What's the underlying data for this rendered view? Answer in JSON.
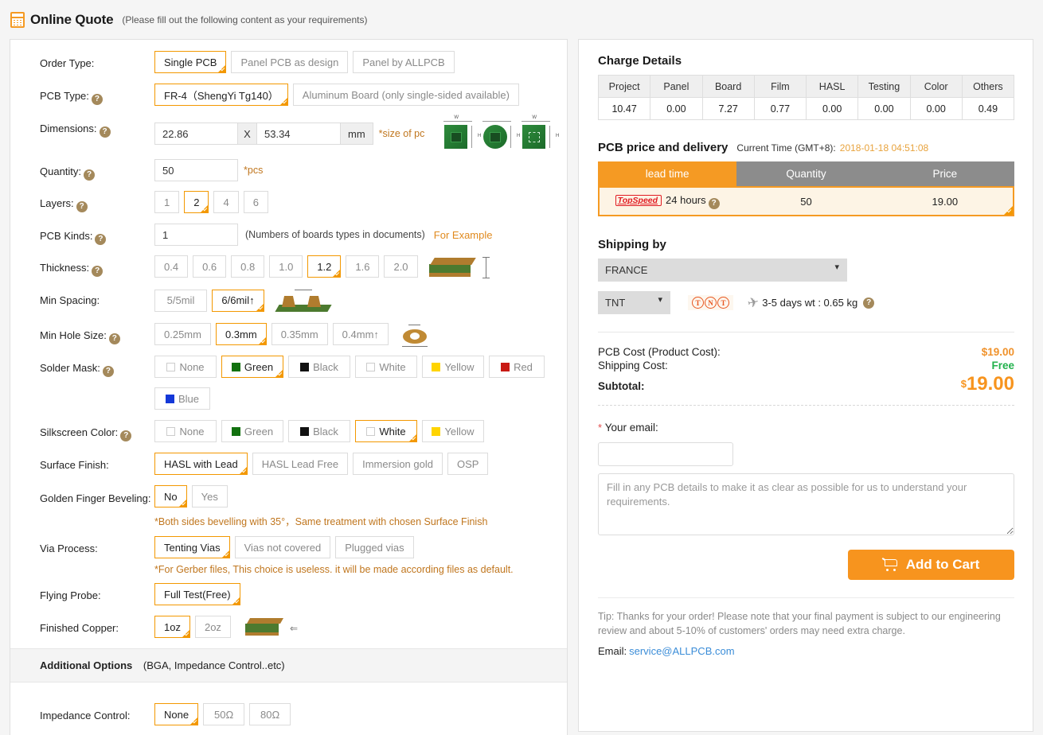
{
  "header": {
    "title": "Online Quote",
    "note": "(Please fill out the following content as your requirements)",
    "icon": "calculator-icon"
  },
  "form": {
    "order_type": {
      "label": "Order Type:",
      "options": [
        "Single PCB",
        "Panel PCB as design",
        "Panel by ALLPCB"
      ],
      "selected": "Single PCB"
    },
    "pcb_type": {
      "label": "PCB Type:",
      "options": [
        "FR-4（ShengYi Tg140）",
        "Aluminum Board (only single-sided available)"
      ],
      "selected": "FR-4（ShengYi Tg140）"
    },
    "dimensions": {
      "label": "Dimensions:",
      "width": "22.86",
      "separator": "X",
      "height": "53.34",
      "unit": "mm",
      "note": "*size of pc"
    },
    "quantity": {
      "label": "Quantity:",
      "value": "50",
      "note": "*pcs"
    },
    "layers": {
      "label": "Layers:",
      "options": [
        "1",
        "2",
        "4",
        "6"
      ],
      "selected": "2"
    },
    "pcb_kinds": {
      "label": "PCB Kinds:",
      "value": "1",
      "note": "(Numbers of boards types in documents)",
      "link": "For Example"
    },
    "thickness": {
      "label": "Thickness:",
      "options": [
        "0.4",
        "0.6",
        "0.8",
        "1.0",
        "1.2",
        "1.6",
        "2.0"
      ],
      "selected": "1.2"
    },
    "min_spacing": {
      "label": "Min Spacing:",
      "options": [
        "5/5mil",
        "6/6mil↑"
      ],
      "selected": "6/6mil↑"
    },
    "min_hole_size": {
      "label": "Min Hole Size:",
      "options": [
        "0.25mm",
        "0.3mm",
        "0.35mm",
        "0.4mm↑"
      ],
      "selected": "0.3mm"
    },
    "solder_mask": {
      "label": "Solder Mask:",
      "options": [
        {
          "name": "None",
          "color": ""
        },
        {
          "name": "Green",
          "color": "#12710f"
        },
        {
          "name": "Black",
          "color": "#111111"
        },
        {
          "name": "White",
          "color": ""
        },
        {
          "name": "Yellow",
          "color": "#ffd400"
        },
        {
          "name": "Red",
          "color": "#c81a14"
        },
        {
          "name": "Blue",
          "color": "#1438d8"
        }
      ],
      "selected": "Green"
    },
    "silkscreen_color": {
      "label": "Silkscreen Color:",
      "options": [
        {
          "name": "None",
          "color": ""
        },
        {
          "name": "Green",
          "color": "#12710f"
        },
        {
          "name": "Black",
          "color": "#111111"
        },
        {
          "name": "White",
          "color": ""
        },
        {
          "name": "Yellow",
          "color": "#ffd400"
        }
      ],
      "selected": "White"
    },
    "surface_finish": {
      "label": "Surface Finish:",
      "options": [
        "HASL with Lead",
        "HASL Lead Free",
        "Immersion gold",
        "OSP"
      ],
      "selected": "HASL with Lead"
    },
    "golden_finger": {
      "label": "Golden Finger Beveling:",
      "options": [
        "No",
        "Yes"
      ],
      "selected": "No",
      "hint": "*Both sides bevelling with 35°，Same treatment with chosen Surface Finish"
    },
    "via_process": {
      "label": "Via Process:",
      "options": [
        "Tenting Vias",
        "Vias not covered",
        "Plugged vias"
      ],
      "selected": "Tenting Vias",
      "hint": "*For Gerber files, This choice is useless. it will be made according files as default."
    },
    "flying_probe": {
      "label": "Flying Probe:",
      "options": [
        "Full Test(Free)"
      ],
      "selected": "Full Test(Free)"
    },
    "finished_copper": {
      "label": "Finished Copper:",
      "options": [
        "1oz",
        "2oz"
      ],
      "selected": "1oz"
    },
    "additional_options": {
      "title": "Additional Options",
      "subtitle": "(BGA, Impedance Control..etc)"
    },
    "impedance_control": {
      "label": "Impedance Control:",
      "options": [
        "None",
        "50Ω",
        "80Ω"
      ],
      "selected": "None"
    }
  },
  "charge_details": {
    "title": "Charge Details",
    "columns": [
      "Project",
      "Panel",
      "Board",
      "Film",
      "HASL",
      "Testing",
      "Color",
      "Others"
    ],
    "values": [
      "10.47",
      "0.00",
      "7.27",
      "0.77",
      "0.00",
      "0.00",
      "0.00",
      "0.49"
    ]
  },
  "price_delivery": {
    "title": "PCB price and delivery",
    "time_label": "Current Time (GMT+8):",
    "time_value": "2018-01-18 04:51:08",
    "columns": [
      "lead time",
      "Quantity",
      "Price"
    ],
    "row": {
      "badge": "TopSpeed",
      "lead_time": "24 hours",
      "quantity": "50",
      "price": "19.00"
    }
  },
  "shipping": {
    "title": "Shipping by",
    "country": "FRANCE",
    "carrier": "TNT",
    "carrier_logo": "tnt-logo",
    "delivery": "3-5 days wt : 0.65 kg"
  },
  "costs": {
    "pcb_cost_label": "PCB Cost (Product Cost):",
    "pcb_cost_value": "$19.00",
    "shipping_label": "Shipping Cost:",
    "shipping_value": "Free",
    "subtotal_label": "Subtotal:",
    "subtotal_currency": "$",
    "subtotal_value": "19.00"
  },
  "email_section": {
    "label": "Your email:",
    "required_mark": "*",
    "email_value": "",
    "notes_placeholder": "Fill in any PCB details to make it as clear as possible for us to understand your requirements."
  },
  "cart": {
    "label": "Add to Cart",
    "icon": "cart-icon"
  },
  "footer": {
    "tip": "Tip: Thanks for your order! Please note that your final payment is subject to our engineering review and about 5-10% of customers' orders may need extra charge.",
    "email_label": "Email:",
    "email_address": "service@ALLPCB.com"
  },
  "colors": {
    "accent": "#f7941e",
    "selected_border": "#f39800",
    "free_green": "#22b14c",
    "link_blue": "#3b8dd8"
  }
}
